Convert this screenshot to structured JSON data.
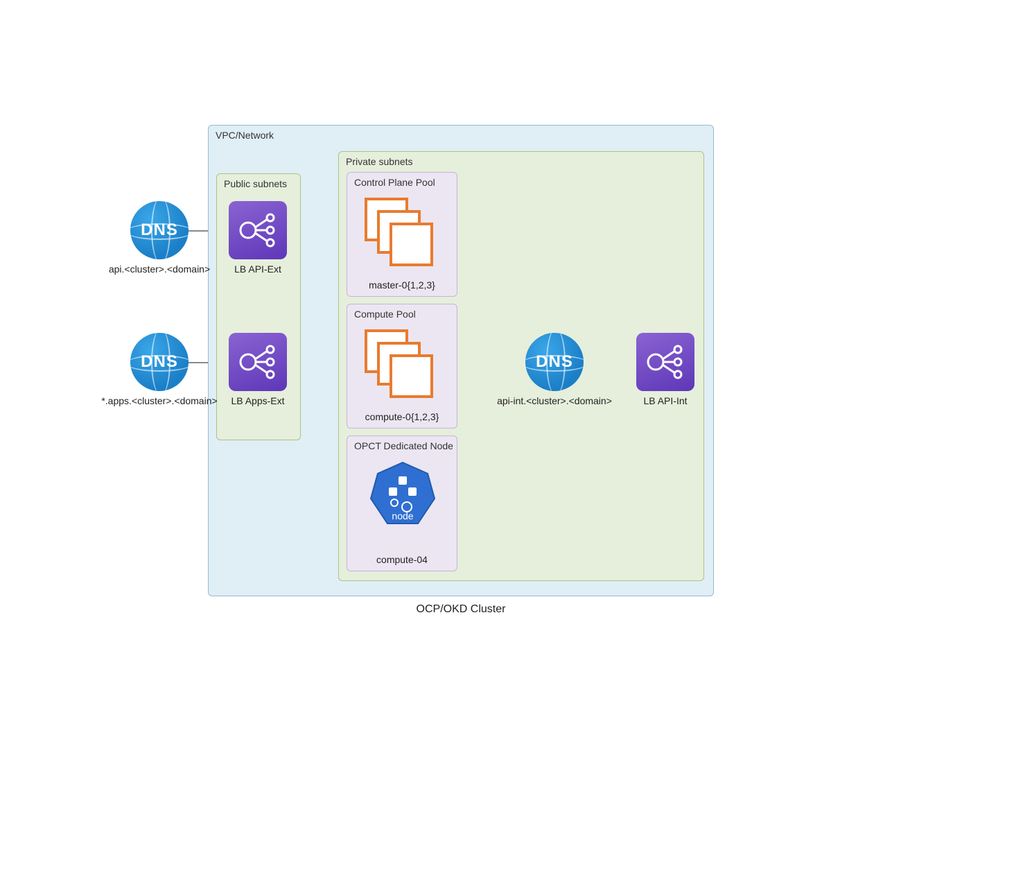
{
  "caption": "OCP/OKD Cluster",
  "vpc": {
    "label": "VPC/Network"
  },
  "public_subnets": {
    "label": "Public subnets"
  },
  "private_subnets": {
    "label": "Private subnets"
  },
  "pools": {
    "control_plane": {
      "label": "Control Plane Pool",
      "members_label": "master-0{1,2,3}"
    },
    "compute": {
      "label": "Compute Pool",
      "members_label": "compute-0{1,2,3}"
    },
    "opct": {
      "label": "OPCT Dedicated Node",
      "members_label": "compute-04"
    }
  },
  "nodes": {
    "dns_api_ext": {
      "glyph": "DNS",
      "caption": "api.<cluster>.<domain>"
    },
    "dns_apps_ext": {
      "glyph": "DNS",
      "caption": "*.apps.<cluster>.<domain>"
    },
    "dns_api_int": {
      "glyph": "DNS",
      "caption": "api-int.<cluster>.<domain>"
    },
    "lb_api_ext": {
      "caption": "LB API-Ext"
    },
    "lb_apps_ext": {
      "caption": "LB Apps-Ext"
    },
    "lb_api_int": {
      "caption": "LB API-Int"
    },
    "k8s_node": {
      "glyph": "node"
    }
  },
  "edges": [
    {
      "from": "dns_api_ext",
      "to": "lb_api_ext"
    },
    {
      "from": "dns_apps_ext",
      "to": "lb_apps_ext"
    },
    {
      "from": "lb_api_ext",
      "to": "control_plane_pool"
    },
    {
      "from": "lb_apps_ext",
      "to": "compute_pool"
    },
    {
      "from": "control_plane_pool",
      "to": "dns_api_int",
      "bent": true
    },
    {
      "from": "compute_pool",
      "to": "dns_api_int"
    },
    {
      "from": "opct_pool",
      "to": "dns_api_int",
      "bent": true
    },
    {
      "from": "dns_api_int",
      "to": "lb_api_int",
      "multi": 4
    },
    {
      "from": "lb_api_int",
      "to": "control_plane_pool",
      "bent": true,
      "back": true
    }
  ],
  "colors": {
    "vpc_bg": "#e0eef5",
    "subnet_bg": "#e6efdb",
    "pool_bg": "#ece6f2",
    "dns": "#1b7fc7",
    "lb": "#6b3fc0",
    "compute_border": "#e87b2f",
    "k8s": "#2f6fd1",
    "arrow": "#636363"
  }
}
